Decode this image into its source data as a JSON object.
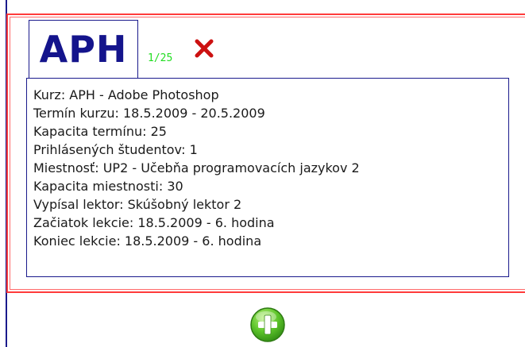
{
  "course": {
    "code": "APH",
    "capacity_badge": "1/25",
    "details": [
      "Kurz: APH - Adobe Photoshop",
      "Termín kurzu: 18.5.2009 - 20.5.2009",
      "Kapacita termínu: 25",
      "Prihlásených študentov: 1",
      "Miestnosť: UP2 - Učebňa programovacích jazykov 2",
      "Kapacita miestnosti: 30",
      "Vypísal lektor: Skúšobný lektor 2",
      "Začiatok lekcie: 18.5.2009 - 6. hodina",
      "Koniec lekcie: 18.5.2009 - 6. hodina"
    ]
  },
  "icons": {
    "remove": "close-icon",
    "add": "plus-icon"
  },
  "colors": {
    "cell_border": "#ff3b3b",
    "box_border": "#1a1a8c",
    "code_text": "#14148c",
    "badge": "#22dd22",
    "remove_icon": "#cc1111",
    "add_icon": "#4cbb1e"
  }
}
